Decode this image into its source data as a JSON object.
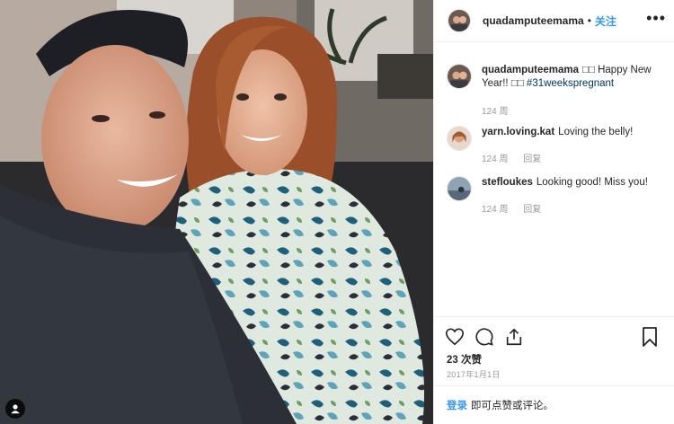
{
  "post": {
    "username": "quadamputeemama",
    "dot": "•",
    "follow_label": "关注",
    "more_icon": "more-options-icon",
    "comments": [
      {
        "username": "quadamputeemama",
        "text_prefix": "□□ Happy New Year!! □□ ",
        "hashtag": "#31weekspregnant",
        "time": "124 周",
        "reply_label": ""
      },
      {
        "username": "yarn.loving.kat",
        "text_prefix": "Loving the belly!",
        "hashtag": "",
        "time": "124 周",
        "reply_label": "回复"
      },
      {
        "username": "stefloukes",
        "text_prefix": "Looking good! Miss you!",
        "hashtag": "",
        "time": "124 周",
        "reply_label": "回复"
      }
    ],
    "likes": "23 次赞",
    "date": "2017年1月1日",
    "login_link": "登录",
    "login_text": "即可点赞或评论。"
  },
  "colors": {
    "link_blue": "#3897f0",
    "hashtag_blue": "#003569",
    "meta_gray": "#999999",
    "border": "#efefef"
  }
}
